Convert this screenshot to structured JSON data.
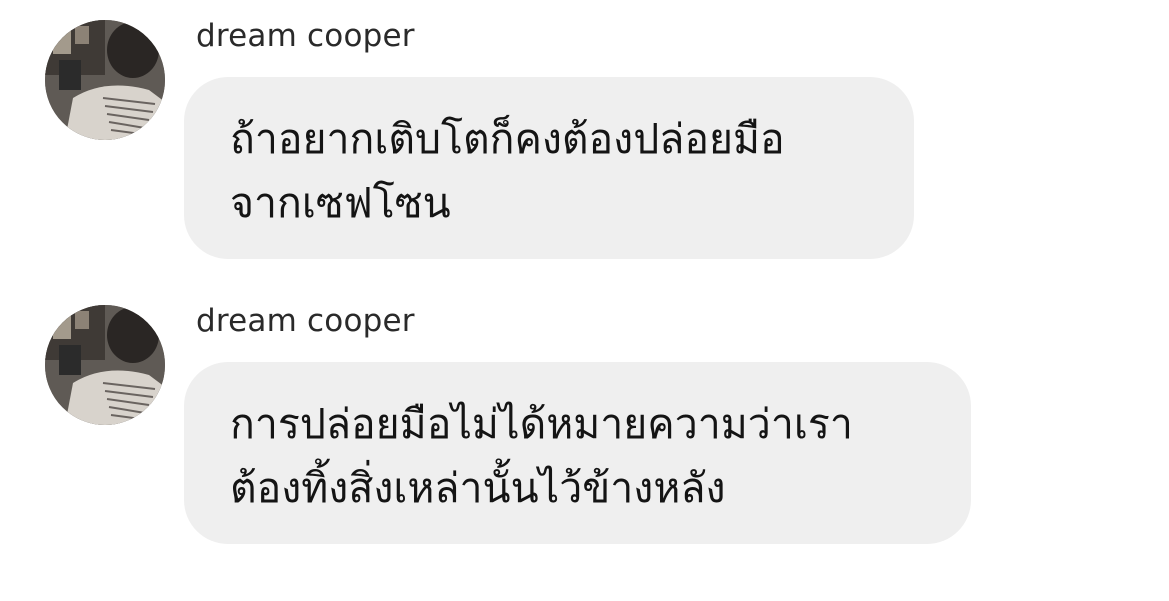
{
  "messages": [
    {
      "sender": "dream cooper",
      "avatar_icon": "profile-photo",
      "lines": [
        "ถ้าอยากเติบโตก็คงต้องปล่อยมือ",
        "จากเซฟโซน"
      ]
    },
    {
      "sender": "dream cooper",
      "avatar_icon": "profile-photo",
      "lines": [
        "การปล่อยมือไม่ได้หมายความว่าเรา",
        "ต้องทิ้งสิ่งเหล่านั้นไว้ข้างหลัง"
      ]
    }
  ],
  "colors": {
    "background": "#ffffff",
    "bubble": "#efefef",
    "text": "#141414",
    "sender": "#2a2a2a"
  }
}
